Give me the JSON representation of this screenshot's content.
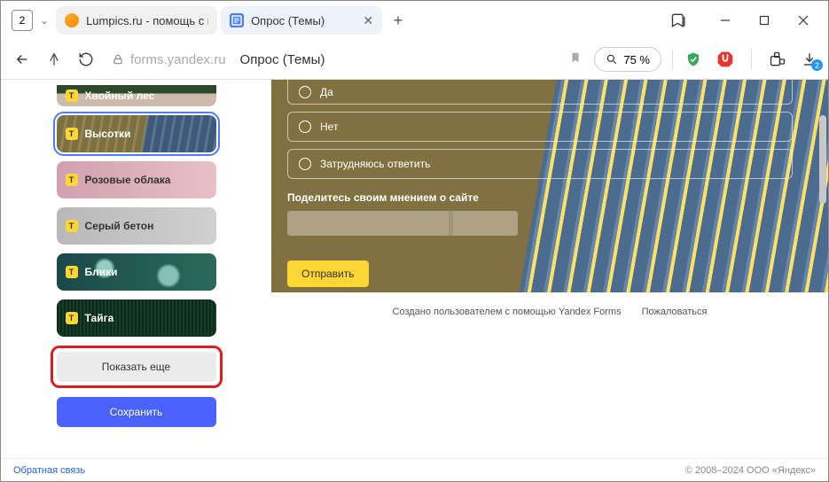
{
  "titlebar": {
    "tab_count": "2",
    "tabs": [
      {
        "label": "Lumpics.ru - помощь с ко"
      },
      {
        "label": "Опрос (Темы)"
      }
    ]
  },
  "addressbar": {
    "host": "forms.yandex.ru",
    "title": "Опрос (Темы)",
    "zoom": "75 %",
    "download_badge": "2"
  },
  "sidebar": {
    "themes": [
      {
        "label": "Хвойный лес"
      },
      {
        "label": "Высотки"
      },
      {
        "label": "Розовые облака"
      },
      {
        "label": "Серый бетон"
      },
      {
        "label": "Блики"
      },
      {
        "label": "Тайга"
      }
    ],
    "show_more": "Показать еще",
    "save": "Сохранить"
  },
  "form": {
    "options": [
      {
        "label": "Да"
      },
      {
        "label": "Нет"
      },
      {
        "label": "Затрудняюсь ответить"
      }
    ],
    "opinion_label": "Поделитесь своим мнением о сайте",
    "submit": "Отправить",
    "footer_created": "Создано пользователем с помощью Yandex Forms",
    "footer_report": "Пожаловаться"
  },
  "footer": {
    "feedback": "Обратная связь",
    "copyright": "© 2008–2024  ООО «Яндекс»"
  }
}
